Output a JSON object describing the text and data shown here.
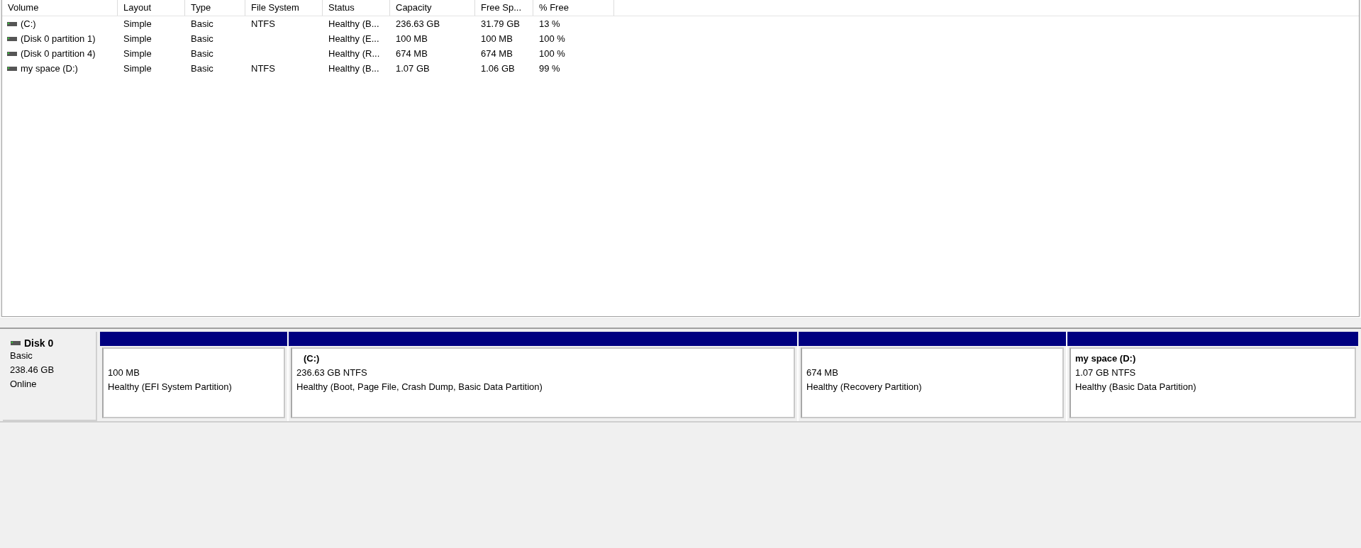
{
  "table": {
    "columns": [
      "Volume",
      "Layout",
      "Type",
      "File System",
      "Status",
      "Capacity",
      "Free Sp...",
      "% Free"
    ],
    "rows": [
      {
        "cells": [
          "(C:)",
          "Simple",
          "Basic",
          "NTFS",
          "Healthy (B...",
          "236.63 GB",
          "31.79 GB",
          "13 %"
        ]
      },
      {
        "cells": [
          "(Disk 0 partition 1)",
          "Simple",
          "Basic",
          "",
          "Healthy (E...",
          "100 MB",
          "100 MB",
          "100 %"
        ]
      },
      {
        "cells": [
          "(Disk 0 partition 4)",
          "Simple",
          "Basic",
          "",
          "Healthy (R...",
          "674 MB",
          "674 MB",
          "100 %"
        ]
      },
      {
        "cells": [
          "my space (D:)",
          "Simple",
          "Basic",
          "NTFS",
          "Healthy (B...",
          "1.07 GB",
          "1.06 GB",
          "99 %"
        ]
      }
    ]
  },
  "disk": {
    "name": "Disk 0",
    "type": "Basic",
    "size": "238.46 GB",
    "status": "Online",
    "partitions": [
      {
        "size": "100 MB",
        "status": "Healthy (EFI System Partition)"
      },
      {
        "label": "(C:)",
        "size": "236.63 GB NTFS",
        "status": "Healthy (Boot, Page File, Crash Dump, Basic Data Partition)"
      },
      {
        "size": "674 MB",
        "status": "Healthy (Recovery Partition)"
      },
      {
        "label": "my space  (D:)",
        "size": "1.07 GB NTFS",
        "status": "Healthy (Basic Data Partition)"
      }
    ]
  }
}
